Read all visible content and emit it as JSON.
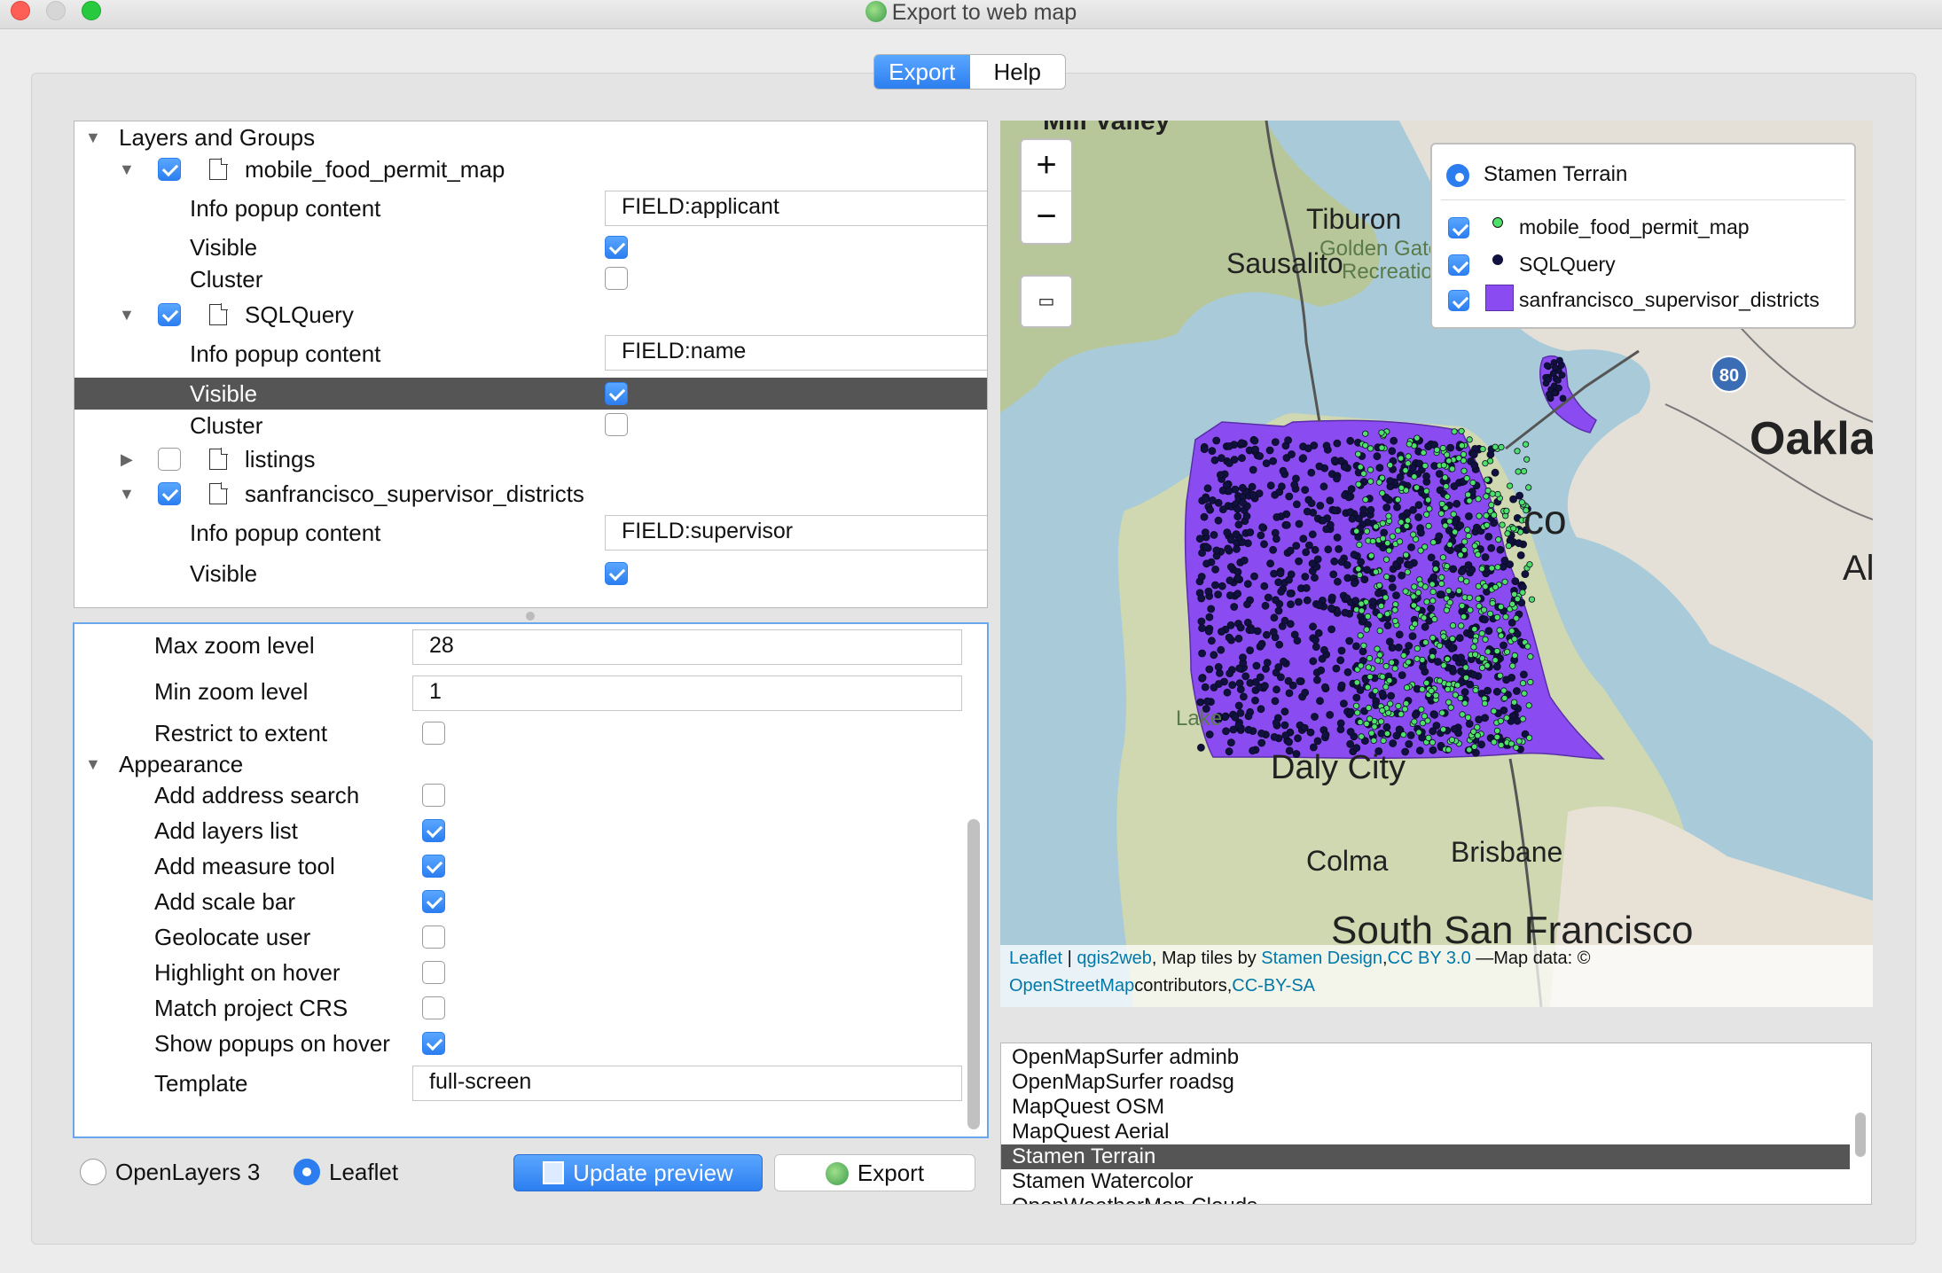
{
  "window": {
    "title": "Export to web map"
  },
  "tabs": {
    "export": "Export",
    "help": "Help"
  },
  "tree": {
    "root": "Layers and Groups",
    "layer1": {
      "name": "mobile_food_permit_map",
      "popup_label": "Info popup content",
      "popup_value": "FIELD:applicant",
      "visible_label": "Visible",
      "cluster_label": "Cluster"
    },
    "layer2": {
      "name": "SQLQuery",
      "popup_label": "Info popup content",
      "popup_value": "FIELD:name",
      "visible_label": "Visible",
      "cluster_label": "Cluster"
    },
    "layer3": {
      "name": "listings"
    },
    "layer4": {
      "name": "sanfrancisco_supervisor_districts",
      "popup_label": "Info popup content",
      "popup_value": "FIELD:supervisor",
      "visible_label": "Visible"
    }
  },
  "settings": {
    "max_zoom_label": "Max zoom level",
    "max_zoom_value": "28",
    "min_zoom_label": "Min zoom level",
    "min_zoom_value": "1",
    "restrict_label": "Restrict to extent",
    "appearance_label": "Appearance",
    "address_search": "Add address search",
    "layers_list": "Add layers list",
    "measure_tool": "Add measure tool",
    "scale_bar": "Add scale bar",
    "geolocate": "Geolocate user",
    "highlight": "Highlight on hover",
    "match_crs": "Match project CRS",
    "popups_hover": "Show popups on hover",
    "template_label": "Template",
    "template_value": "full-screen"
  },
  "bottom": {
    "openlayers": "OpenLayers 3",
    "leaflet": "Leaflet",
    "update_preview": "Update preview",
    "export": "Export"
  },
  "map": {
    "zoom_in": "+",
    "zoom_out": "−",
    "legend": {
      "basemap": "Stamen Terrain",
      "layer1": "mobile_food_permit_map",
      "layer2": "SQLQuery",
      "layer3": "sanfrancisco_supervisor_districts"
    },
    "labels": {
      "tiburon": "Tiburon",
      "sausalito": "Sausalito",
      "golden_gate": "Golden Gate",
      "recreation": "Recreation",
      "oakland": "Oaklan",
      "daly_city": "Daly City",
      "colma": "Colma",
      "brisbane": "Brisbane",
      "south_sf": "South San Francisco",
      "lake": "Lake",
      "co": "co",
      "ala": "Al",
      "highway": "80",
      "mill_valley": "Mill Valley"
    },
    "attribution": {
      "leaflet": "Leaflet",
      "sep": " | ",
      "qgis2web": "qgis2web",
      "tiles_text": ", Map tiles by ",
      "stamen": "Stamen Design",
      "comma": ",",
      "cc": "CC BY 3.0",
      "data_text": " —Map data: ©",
      "osm": "OpenStreetMap",
      "contrib": "contributors,",
      "ccbysa": "CC-BY-SA"
    }
  },
  "basemaps": [
    "OpenMapSurfer adminb",
    "OpenMapSurfer roadsg",
    "MapQuest OSM",
    "MapQuest Aerial",
    "Stamen Terrain",
    "Stamen Watercolor",
    "OpenWeatherMap Clouds"
  ],
  "colors": {
    "accent": "#2c7ef0",
    "district_fill": "#8a4cf0",
    "food_points": "#4ee06a",
    "sql_points": "#111140"
  }
}
